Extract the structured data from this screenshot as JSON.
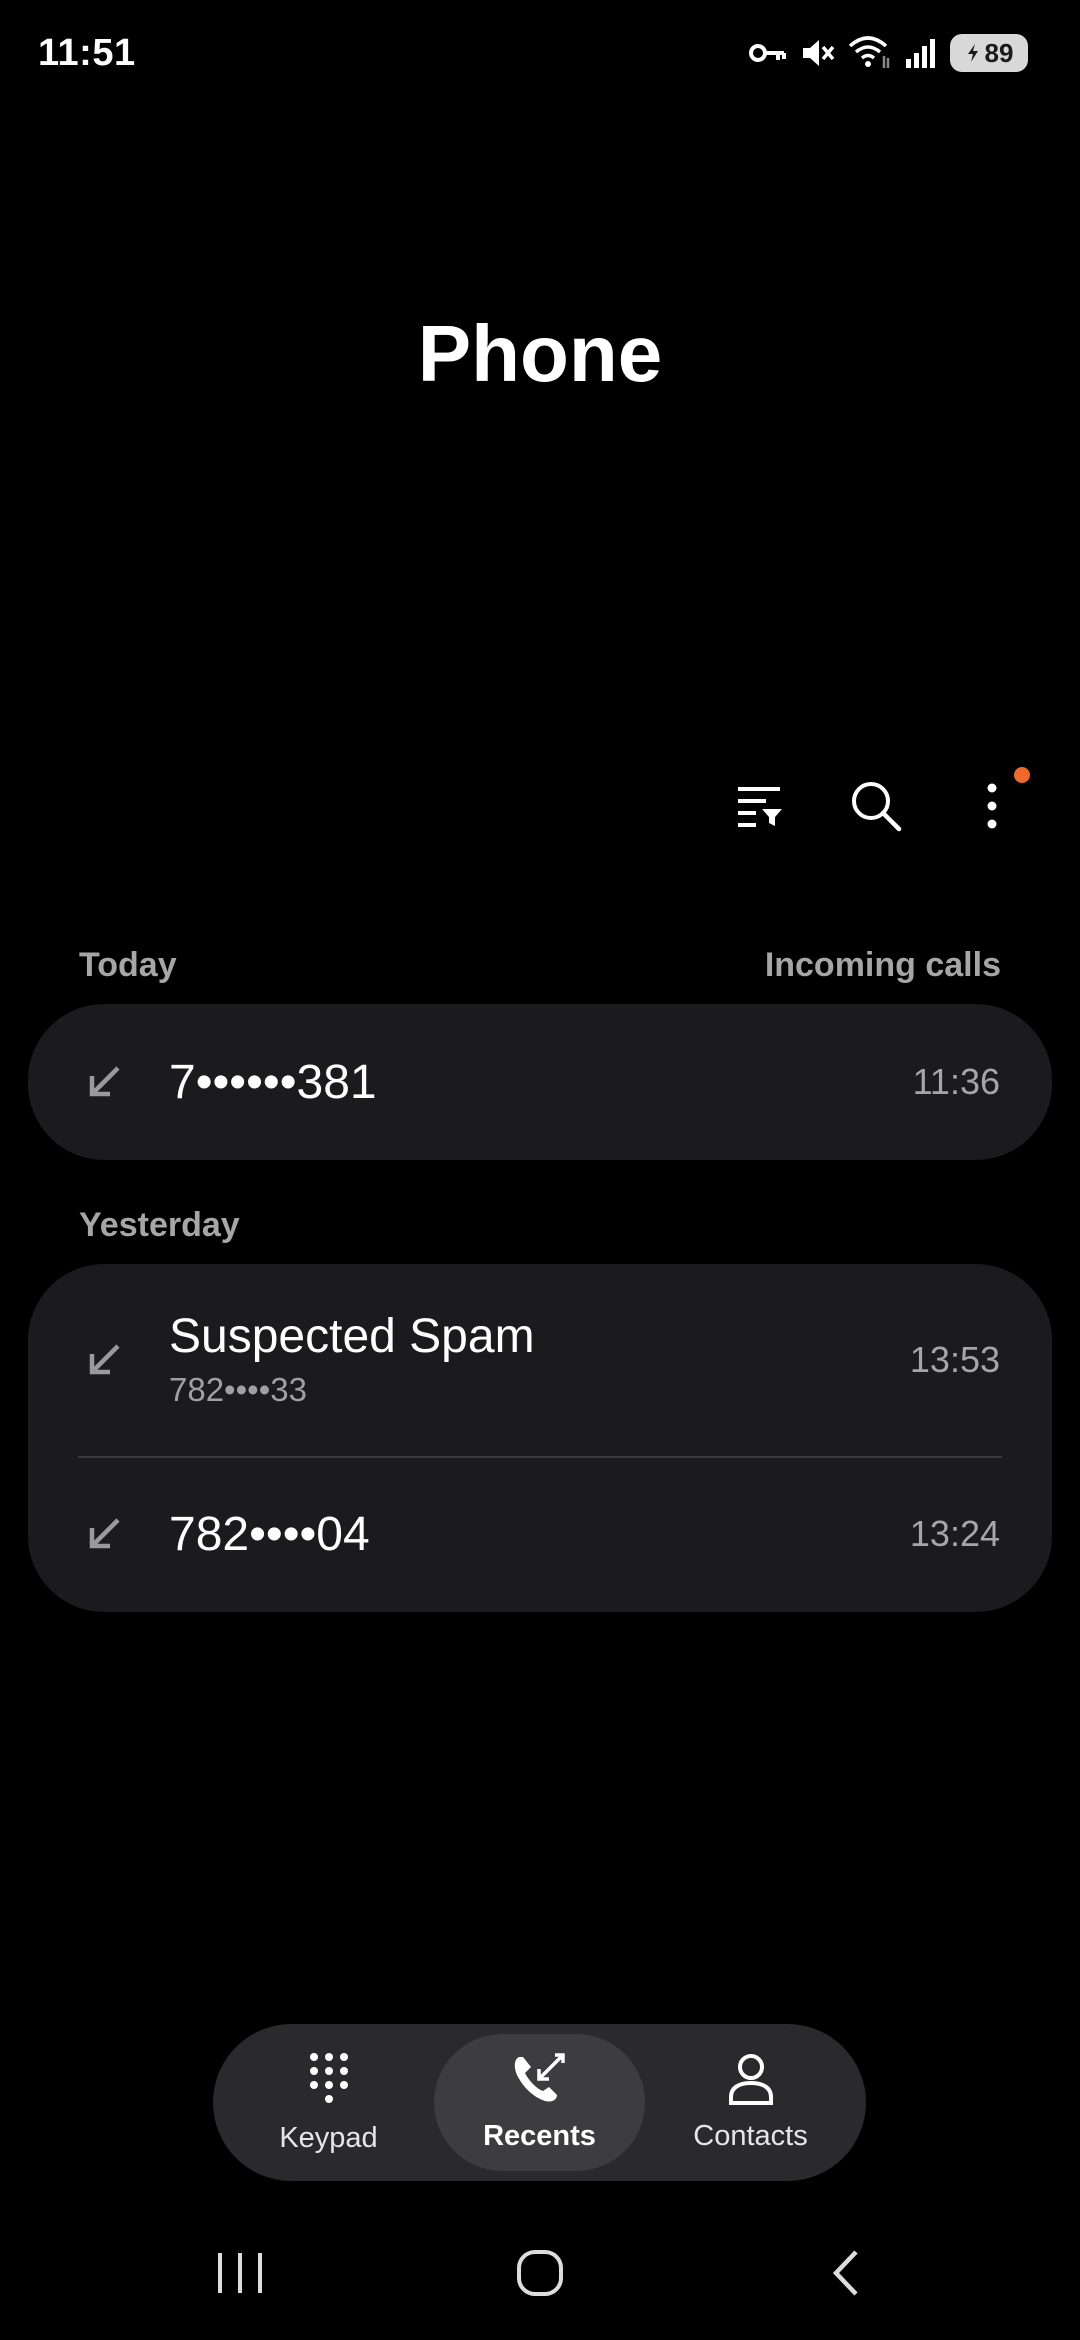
{
  "status_bar": {
    "time": "11:51",
    "battery": "89",
    "icons": [
      "vpn-key-icon",
      "mute-icon",
      "wifi-icon",
      "signal-icon",
      "battery-icon"
    ]
  },
  "title": "Phone",
  "toolbar": {
    "icons": [
      "filter-icon",
      "search-icon",
      "more-vert-icon"
    ],
    "accent": "#ee6a2a"
  },
  "sections": [
    {
      "label": "Today",
      "filter_label": "Incoming calls",
      "calls": [
        {
          "number": "7••••••381",
          "time": "11:36",
          "type": "incoming"
        }
      ]
    },
    {
      "label": "Yesterday",
      "calls": [
        {
          "name": "Suspected Spam",
          "number": "782••••33",
          "time": "13:53",
          "type": "incoming"
        },
        {
          "number": "782••••04",
          "time": "13:24",
          "type": "incoming"
        }
      ]
    }
  ],
  "bottom_nav": {
    "items": [
      {
        "label": "Keypad",
        "icon": "keypad-icon",
        "active": false
      },
      {
        "label": "Recents",
        "icon": "recents-icon",
        "active": true
      },
      {
        "label": "Contacts",
        "icon": "contacts-icon",
        "active": false
      }
    ]
  },
  "system_nav": [
    "recent-apps-icon",
    "home-icon",
    "back-icon"
  ]
}
